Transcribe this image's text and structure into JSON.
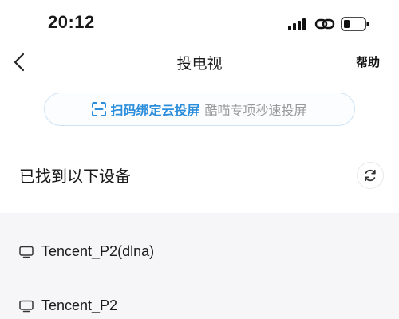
{
  "status_bar": {
    "time": "20:12",
    "icons": [
      "signal-icon",
      "link-icon",
      "battery-icon"
    ]
  },
  "nav": {
    "title": "投电视",
    "help_label": "帮助",
    "back_icon": "chevron-left-icon"
  },
  "scan_banner": {
    "primary_text": "扫码绑定云投屏",
    "secondary_text": "酷喵专项秒速投屏",
    "icon": "scan-icon",
    "accent_color": "#2c8ddb"
  },
  "devices": {
    "header": "已找到以下设备",
    "refresh_icon": "refresh-icon",
    "items": [
      {
        "name": "Tencent_P2(dlna)",
        "icon": "tv-icon"
      },
      {
        "name": "Tencent_P2",
        "icon": "tv-icon"
      }
    ]
  }
}
